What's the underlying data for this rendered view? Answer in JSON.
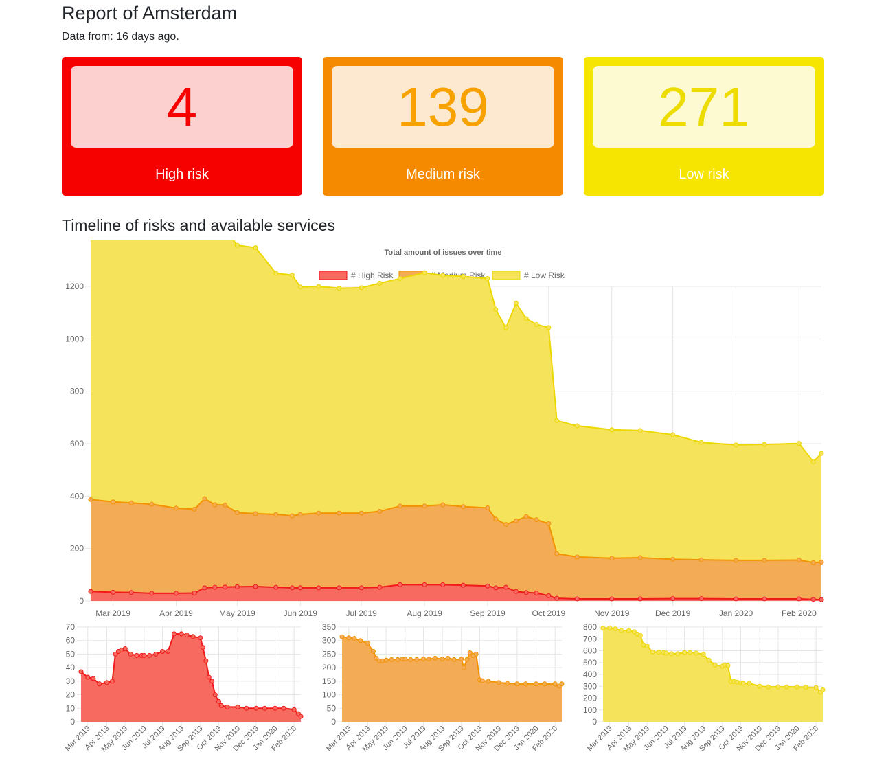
{
  "page": {
    "title": "Report of Amsterdam",
    "subtitle": "Data from: 16 days ago.",
    "section_title": "Timeline of risks and available services"
  },
  "cards": [
    {
      "value": "4",
      "label": "High risk",
      "color": "#f70000"
    },
    {
      "value": "139",
      "label": "Medium risk",
      "color": "#f58a00"
    },
    {
      "value": "271",
      "label": "Low risk",
      "color": "#f5e500"
    }
  ],
  "colors": {
    "high_fill": "#f76a60",
    "high_line": "#f01818",
    "medium_fill": "#f4ab55",
    "medium_line": "#f29300",
    "low_fill": "#f5e35c",
    "low_line": "#ecd800"
  },
  "chart_data": [
    {
      "type": "area",
      "title": "Total amount of issues over time",
      "stacked": true,
      "legend_position": "top",
      "legend": [
        "# High Risk",
        "# Medium Risk",
        "# Low Risk"
      ],
      "x_tick_labels": [
        "Mar 2019",
        "Apr 2019",
        "May 2019",
        "Jun 2019",
        "Jul 2019",
        "Aug 2019",
        "Sep 2019",
        "Oct 2019",
        "Nov 2019",
        "Dec 2019",
        "Jan 2020",
        "Feb 2020"
      ],
      "ylim": [
        0,
        1200
      ],
      "y_ticks": [
        0,
        200,
        400,
        600,
        800,
        1000,
        1200
      ],
      "grid": true,
      "x_dates": [
        "2019-02-18",
        "2019-03-01",
        "2019-03-10",
        "2019-03-20",
        "2019-04-01",
        "2019-04-10",
        "2019-04-15",
        "2019-04-20",
        "2019-04-25",
        "2019-05-01",
        "2019-05-10",
        "2019-05-20",
        "2019-05-28",
        "2019-06-01",
        "2019-06-10",
        "2019-06-20",
        "2019-07-01",
        "2019-07-10",
        "2019-07-20",
        "2019-08-01",
        "2019-08-10",
        "2019-08-20",
        "2019-09-01",
        "2019-09-05",
        "2019-09-10",
        "2019-09-15",
        "2019-09-20",
        "2019-09-25",
        "2019-10-01",
        "2019-10-05",
        "2019-10-15",
        "2019-11-01",
        "2019-11-15",
        "2019-12-01",
        "2019-12-15",
        "2020-01-01",
        "2020-01-15",
        "2020-02-01",
        "2020-02-08",
        "2020-02-12"
      ],
      "series": [
        {
          "name": "# High Risk",
          "values": [
            36,
            33,
            32,
            29,
            29,
            30,
            50,
            52,
            53,
            54,
            55,
            52,
            50,
            50,
            50,
            50,
            50,
            52,
            62,
            62,
            62,
            60,
            57,
            50,
            52,
            36,
            32,
            30,
            20,
            10,
            8,
            8,
            8,
            9,
            9,
            8,
            8,
            8,
            6,
            5
          ]
        },
        {
          "name": "# Medium Risk",
          "values": [
            351,
            345,
            342,
            340,
            325,
            320,
            340,
            315,
            313,
            283,
            278,
            278,
            275,
            280,
            285,
            285,
            285,
            290,
            300,
            300,
            305,
            300,
            298,
            262,
            240,
            270,
            290,
            280,
            275,
            170,
            160,
            155,
            157,
            150,
            148,
            147,
            147,
            148,
            140,
            143
          ]
        },
        {
          "name": "# Low Risk",
          "values": [
            1140,
            1137,
            1125,
            1135,
            1100,
            1090,
            1105,
            1090,
            1050,
            1020,
            1015,
            920,
            918,
            868,
            865,
            858,
            860,
            870,
            868,
            890,
            875,
            878,
            875,
            800,
            750,
            830,
            755,
            745,
            748,
            508,
            500,
            490,
            485,
            475,
            448,
            440,
            442,
            445,
            385,
            415
          ]
        }
      ]
    },
    {
      "type": "area",
      "series_name": "# High Risk",
      "ylim": [
        0,
        70
      ],
      "y_ticks": [
        0,
        10,
        20,
        30,
        40,
        50,
        60,
        70
      ],
      "x_tick_labels": [
        "Mar 2019",
        "Apr 2019",
        "May 2019",
        "Jun 2019",
        "Jul 2019",
        "Aug 2019",
        "Sep 2019",
        "Oct 2019",
        "Nov 2019",
        "Dec 2019",
        "Jan 2020",
        "Feb 2020"
      ],
      "x_dates": [
        "2019-02-18",
        "2019-03-01",
        "2019-03-10",
        "2019-03-20",
        "2019-04-01",
        "2019-04-10",
        "2019-04-15",
        "2019-04-20",
        "2019-04-25",
        "2019-05-01",
        "2019-05-10",
        "2019-05-20",
        "2019-05-28",
        "2019-06-01",
        "2019-06-10",
        "2019-06-20",
        "2019-07-01",
        "2019-07-10",
        "2019-07-20",
        "2019-08-01",
        "2019-08-10",
        "2019-08-20",
        "2019-09-01",
        "2019-09-05",
        "2019-09-10",
        "2019-09-15",
        "2019-09-20",
        "2019-09-25",
        "2019-10-01",
        "2019-10-05",
        "2019-10-15",
        "2019-11-01",
        "2019-11-15",
        "2019-12-01",
        "2019-12-15",
        "2020-01-01",
        "2020-01-15",
        "2020-02-01",
        "2020-02-08",
        "2020-02-12"
      ],
      "values": [
        37,
        33,
        32,
        28,
        29,
        30,
        50,
        52,
        53,
        54,
        50,
        49,
        49,
        49,
        49,
        50,
        52,
        52,
        65,
        65,
        64,
        63,
        62,
        55,
        45,
        33,
        30,
        20,
        15,
        12,
        11,
        11,
        10,
        10,
        10,
        10,
        10,
        9,
        6,
        4
      ]
    },
    {
      "type": "area",
      "series_name": "# Medium Risk",
      "ylim": [
        0,
        350
      ],
      "y_ticks": [
        0,
        50,
        100,
        150,
        200,
        250,
        300,
        350
      ],
      "x_tick_labels": [
        "Mar 2019",
        "Apr 2019",
        "May 2019",
        "Jun 2019",
        "Jul 2019",
        "Aug 2019",
        "Sep 2019",
        "Oct 2019",
        "Nov 2019",
        "Dec 2019",
        "Jan 2020",
        "Feb 2020"
      ],
      "x_dates": [
        "2019-02-18",
        "2019-03-01",
        "2019-03-10",
        "2019-03-20",
        "2019-04-01",
        "2019-04-10",
        "2019-04-15",
        "2019-04-20",
        "2019-04-25",
        "2019-05-01",
        "2019-05-10",
        "2019-05-20",
        "2019-05-28",
        "2019-06-01",
        "2019-06-10",
        "2019-06-20",
        "2019-07-01",
        "2019-07-10",
        "2019-07-20",
        "2019-08-01",
        "2019-08-10",
        "2019-08-20",
        "2019-09-01",
        "2019-09-05",
        "2019-09-10",
        "2019-09-15",
        "2019-09-20",
        "2019-09-25",
        "2019-10-01",
        "2019-10-05",
        "2019-10-15",
        "2019-11-01",
        "2019-11-15",
        "2019-12-01",
        "2019-12-15",
        "2020-01-01",
        "2020-01-15",
        "2020-02-01",
        "2020-02-08",
        "2020-02-12"
      ],
      "values": [
        314,
        310,
        308,
        300,
        290,
        260,
        235,
        225,
        225,
        228,
        230,
        230,
        232,
        232,
        230,
        230,
        232,
        232,
        235,
        232,
        235,
        230,
        232,
        200,
        230,
        255,
        245,
        250,
        155,
        152,
        150,
        145,
        142,
        140,
        140,
        140,
        140,
        140,
        132,
        140
      ]
    },
    {
      "type": "area",
      "series_name": "# Low Risk",
      "ylim": [
        0,
        800
      ],
      "y_ticks": [
        0,
        100,
        200,
        300,
        400,
        500,
        600,
        700,
        800
      ],
      "x_tick_labels": [
        "Mar 2019",
        "Apr 2019",
        "May 2019",
        "Jun 2019",
        "Jul 2019",
        "Aug 2019",
        "Sep 2019",
        "Oct 2019",
        "Nov 2019",
        "Dec 2019",
        "Jan 2020",
        "Feb 2020"
      ],
      "x_dates": [
        "2019-02-18",
        "2019-03-01",
        "2019-03-10",
        "2019-03-20",
        "2019-04-01",
        "2019-04-10",
        "2019-04-15",
        "2019-04-20",
        "2019-04-25",
        "2019-05-01",
        "2019-05-10",
        "2019-05-20",
        "2019-05-28",
        "2019-06-01",
        "2019-06-10",
        "2019-06-20",
        "2019-07-01",
        "2019-07-10",
        "2019-07-20",
        "2019-08-01",
        "2019-08-10",
        "2019-08-20",
        "2019-09-01",
        "2019-09-05",
        "2019-09-10",
        "2019-09-15",
        "2019-09-20",
        "2019-09-25",
        "2019-10-01",
        "2019-10-05",
        "2019-10-15",
        "2019-11-01",
        "2019-11-15",
        "2019-12-01",
        "2019-12-15",
        "2020-01-01",
        "2020-01-15",
        "2020-02-01",
        "2020-02-08",
        "2020-02-12"
      ],
      "values": [
        790,
        792,
        785,
        770,
        770,
        760,
        740,
        730,
        650,
        640,
        590,
        588,
        585,
        580,
        575,
        575,
        585,
        585,
        580,
        570,
        520,
        480,
        470,
        480,
        475,
        340,
        340,
        335,
        330,
        325,
        325,
        300,
        295,
        295,
        295,
        295,
        292,
        290,
        250,
        270
      ]
    }
  ]
}
